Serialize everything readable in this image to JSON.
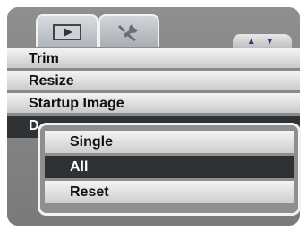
{
  "tabs": [
    {
      "name": "playback",
      "icon": "play-icon"
    },
    {
      "name": "setup",
      "icon": "wrench-icon"
    }
  ],
  "scroll_indicator": {
    "text": "▲ ▼",
    "icon": "up-down-arrows-icon"
  },
  "menu": {
    "items": [
      {
        "label": "Trim"
      },
      {
        "label": "Resize"
      },
      {
        "label": "Startup Image"
      },
      {
        "label": "D"
      }
    ]
  },
  "submenu": {
    "items": [
      {
        "label": "Single"
      },
      {
        "label": "All"
      },
      {
        "label": "Reset"
      }
    ]
  },
  "colors": {
    "background": "#8f8f8f",
    "highlight": "#2f3235",
    "highlight_text": "#ffffff",
    "arrow_color": "#1a3a8a"
  }
}
